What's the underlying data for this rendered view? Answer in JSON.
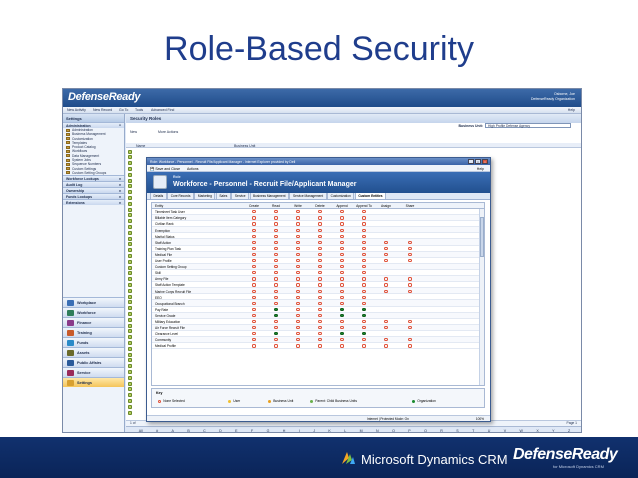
{
  "slide": {
    "title": "Role-Based Security"
  },
  "app": {
    "logo": "DefenseReady",
    "user_name": "Osborne, Joe",
    "user_org": "DefenseReady Organization",
    "menubar": {
      "new_activity": "New Activity",
      "new_record": "New Record",
      "go_to": "Go To",
      "tools": "Tools",
      "advanced_find": "Advanced Find",
      "help": "Help"
    }
  },
  "sidebar": {
    "title": "Settings",
    "admin_label": "Administration",
    "admin_items": [
      "Administration",
      "Business Management",
      "Customization",
      "Templates",
      "Product Catalog",
      "Workflows",
      "Data Management",
      "System Jobs",
      "Sequence Numbers",
      "Custom Settings",
      "Custom Setting Groups"
    ],
    "sections": [
      "Workforce Lookups",
      "Audit Log",
      "Ownership",
      "Funds Lookups",
      "Extensions"
    ],
    "big_buttons": [
      "Workplace",
      "Workforce",
      "Finance",
      "Training",
      "Funds",
      "Assets",
      "Public Affairs",
      "Service",
      "Settings"
    ]
  },
  "main": {
    "title": "Security Roles",
    "business_unit_label": "Business Unit:",
    "business_unit_value": "High Profile Defense Agency",
    "toolbar_more": "More Actions",
    "toolbar_new": "New",
    "col_name": "Name",
    "col_bu": "Business Unit",
    "footer_left": "1 of",
    "footer_right": "Page 1",
    "alphabet": [
      "All",
      "#",
      "A",
      "B",
      "C",
      "D",
      "E",
      "F",
      "G",
      "H",
      "I",
      "J",
      "K",
      "L",
      "M",
      "N",
      "O",
      "P",
      "Q",
      "R",
      "S",
      "T",
      "U",
      "V",
      "W",
      "X",
      "Y",
      "Z"
    ]
  },
  "dialog": {
    "titlebar": "Role: Workforce - Personnel - Recruit File/Applicant Manager - Internet Explorer provided by Dell",
    "save_close": "Save and Close",
    "actions": "Actions",
    "help": "Help",
    "record_type": "Role",
    "record_name": "Workforce - Personnel - Recruit File/Applicant Manager",
    "tabs": [
      "Details",
      "Core Records",
      "Marketing",
      "Sales",
      "Service",
      "Business Management",
      "Service Management",
      "Customization",
      "Custom Entities"
    ],
    "active_tab_index": 8,
    "columns": [
      "Entity",
      "Create",
      "Read",
      "Write",
      "Delete",
      "Append",
      "Append To",
      "Assign",
      "Share"
    ],
    "rows": [
      {
        "entity": "Timesheet Task User",
        "v": [
          "n",
          "n",
          "n",
          "n",
          "n",
          "n",
          "",
          ""
        ]
      },
      {
        "entity": "Billable Item Category",
        "v": [
          "n",
          "n",
          "n",
          "n",
          "n",
          "n",
          "",
          ""
        ]
      },
      {
        "entity": "Civilian Rank",
        "v": [
          "n",
          "n",
          "n",
          "n",
          "n",
          "n",
          "",
          ""
        ]
      },
      {
        "entity": "Exemption",
        "v": [
          "n",
          "n",
          "n",
          "n",
          "n",
          "n",
          "",
          ""
        ]
      },
      {
        "entity": "Marital Status",
        "v": [
          "n",
          "n",
          "n",
          "n",
          "n",
          "n",
          "",
          ""
        ]
      },
      {
        "entity": "Staff Action",
        "v": [
          "n",
          "n",
          "n",
          "n",
          "n",
          "n",
          "n",
          "n"
        ]
      },
      {
        "entity": "Training Plan Task",
        "v": [
          "n",
          "n",
          "n",
          "n",
          "n",
          "n",
          "n",
          "n"
        ]
      },
      {
        "entity": "Medical File",
        "v": [
          "n",
          "n",
          "n",
          "n",
          "n",
          "n",
          "n",
          "n"
        ]
      },
      {
        "entity": "User Profile",
        "v": [
          "n",
          "n",
          "n",
          "n",
          "n",
          "n",
          "n",
          "n"
        ]
      },
      {
        "entity": "Custom Setting Group",
        "v": [
          "n",
          "n",
          "n",
          "n",
          "n",
          "n",
          "",
          ""
        ]
      },
      {
        "entity": "Skill",
        "v": [
          "n",
          "n",
          "n",
          "n",
          "n",
          "n",
          "",
          ""
        ]
      },
      {
        "entity": "Army File",
        "v": [
          "n",
          "n",
          "n",
          "n",
          "n",
          "n",
          "n",
          "n"
        ]
      },
      {
        "entity": "Staff Action Template",
        "v": [
          "n",
          "n",
          "n",
          "n",
          "n",
          "n",
          "n",
          "n"
        ]
      },
      {
        "entity": "Marine Corps Recruit File",
        "v": [
          "n",
          "n",
          "n",
          "n",
          "n",
          "n",
          "n",
          "n"
        ]
      },
      {
        "entity": "EEO",
        "v": [
          "n",
          "n",
          "n",
          "n",
          "n",
          "n",
          "",
          ""
        ]
      },
      {
        "entity": "Occupational Branch",
        "v": [
          "n",
          "n",
          "n",
          "n",
          "n",
          "n",
          "",
          ""
        ]
      },
      {
        "entity": "Pay Rate",
        "v": [
          "n",
          "o",
          "n",
          "n",
          "o",
          "o",
          "",
          ""
        ]
      },
      {
        "entity": "Service Grade",
        "v": [
          "n",
          "o",
          "n",
          "n",
          "o",
          "o",
          "",
          ""
        ]
      },
      {
        "entity": "Military Education",
        "v": [
          "n",
          "n",
          "n",
          "n",
          "n",
          "n",
          "n",
          "n"
        ]
      },
      {
        "entity": "Air Force Recruit File",
        "v": [
          "n",
          "n",
          "n",
          "n",
          "n",
          "n",
          "n",
          "n"
        ]
      },
      {
        "entity": "Clearance Level",
        "v": [
          "n",
          "o",
          "n",
          "n",
          "o",
          "o",
          "",
          ""
        ]
      },
      {
        "entity": "Community",
        "v": [
          "n",
          "n",
          "n",
          "n",
          "n",
          "n",
          "n",
          "n"
        ]
      },
      {
        "entity": "Medical Profile",
        "v": [
          "n",
          "n",
          "n",
          "n",
          "n",
          "n",
          "n",
          "n"
        ]
      }
    ],
    "key": {
      "title": "Key",
      "items": [
        "None Selected",
        "User",
        "Business Unit",
        "Parent: Child Business Units",
        "Organization"
      ],
      "colors": {
        "none": "#e0523a",
        "user": "#f0c030",
        "bu": "#e8a020",
        "parent": "#6ab04c",
        "org": "#1a8a2e"
      }
    },
    "status_zone": "Internet | Protected Mode: On",
    "status_zoom": "100%"
  },
  "footer": {
    "ms_text": "Microsoft Dynamics CRM",
    "dr_logo": "DefenseReady",
    "dr_tagline": "for Microsoft Dynamics CRM"
  }
}
